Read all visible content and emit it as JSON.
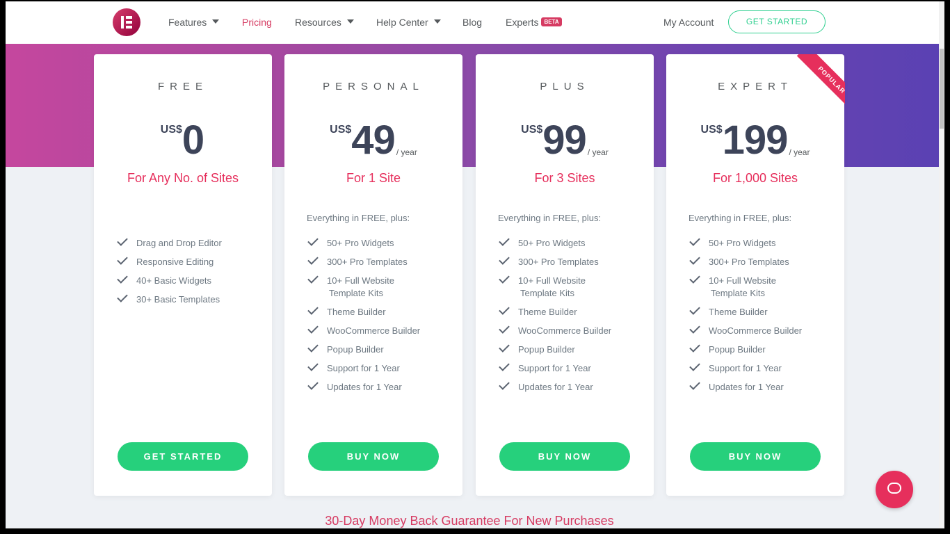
{
  "header": {
    "nav": [
      {
        "label": "Features",
        "caret": true
      },
      {
        "label": "Pricing",
        "active": true
      },
      {
        "label": "Resources",
        "caret": true
      },
      {
        "label": "Help Center",
        "caret": true
      },
      {
        "label": "Blog"
      },
      {
        "label": "Experts",
        "badge": "BETA"
      }
    ],
    "account": "My Account",
    "cta": "GET STARTED"
  },
  "colors": {
    "accent": "#e62f5c",
    "button": "#26d07c",
    "price": "#3d4459"
  },
  "plans": [
    {
      "name": "FREE",
      "currency": "US$",
      "amount": "0",
      "period": "",
      "sites": "For Any No. of Sites",
      "intro": "",
      "features": [
        "Drag and Drop Editor",
        "Responsive Editing",
        "40+ Basic Widgets",
        "30+ Basic Templates"
      ],
      "button": "GET STARTED"
    },
    {
      "name": "PERSONAL",
      "currency": "US$",
      "amount": "49",
      "period": "/ year",
      "sites": "For 1 Site",
      "intro": "Everything in FREE, plus:",
      "features": [
        "50+ Pro Widgets",
        "300+ Pro Templates",
        "10+ Full Website",
        "Template Kits",
        "Theme Builder",
        "WooCommerce Builder",
        "Popup Builder",
        "Support for 1 Year",
        "Updates for 1 Year"
      ],
      "button": "BUY NOW"
    },
    {
      "name": "PLUS",
      "currency": "US$",
      "amount": "99",
      "period": "/ year",
      "sites": "For 3 Sites",
      "intro": "Everything in FREE, plus:",
      "features": [
        "50+ Pro Widgets",
        "300+ Pro Templates",
        "10+ Full Website",
        "Template Kits",
        "Theme Builder",
        "WooCommerce Builder",
        "Popup Builder",
        "Support for 1 Year",
        "Updates for 1 Year"
      ],
      "button": "BUY NOW"
    },
    {
      "name": "EXPERT",
      "currency": "US$",
      "amount": "199",
      "period": "/ year",
      "sites": "For 1,000 Sites",
      "intro": "Everything in FREE, plus:",
      "features": [
        "50+ Pro Widgets",
        "300+ Pro Templates",
        "10+ Full Website",
        "Template Kits",
        "Theme Builder",
        "WooCommerce Builder",
        "Popup Builder",
        "Support for 1 Year",
        "Updates for 1 Year"
      ],
      "button": "BUY NOW",
      "ribbon": "POPULAR"
    }
  ],
  "guarantee": "30-Day Money Back Guarantee For New Purchases",
  "chat_icon": "chat-bubble-icon"
}
